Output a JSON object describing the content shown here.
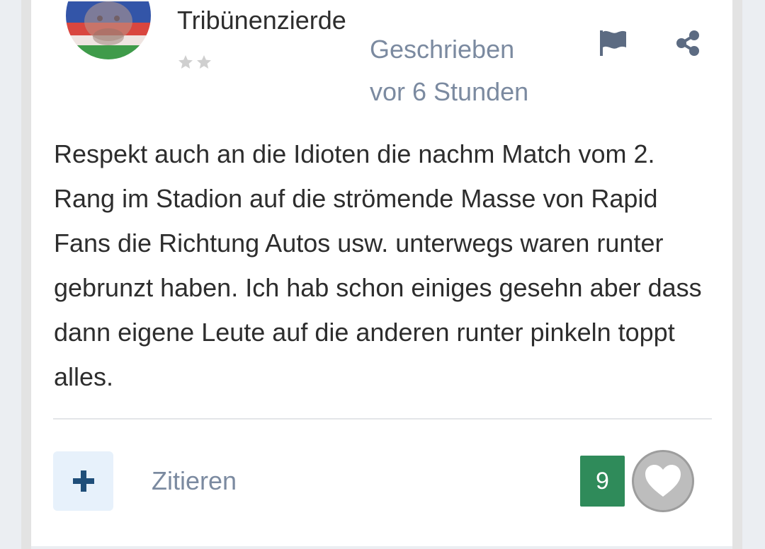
{
  "post": {
    "author_name": "Tribünenzierde",
    "rank_stars": 2,
    "date_line1": "Geschrieben",
    "date_line2": "vor 6 Stunden",
    "body": "Respekt auch an die Idioten die nachm Match vom 2. Rang im Stadion auf die strömende Masse von Rapid Fans die Richtung Autos usw. unterwegs waren runter gebrunzt haben. Ich hab schon einiges gesehn aber dass dann eigene Leute auf die anderen runter pinkeln toppt alles."
  },
  "actions": {
    "plus_icon": "plus-icon",
    "quote_label": "Zitieren",
    "like_count": "9",
    "like_icon": "heart-icon",
    "report_icon": "flag-icon",
    "share_icon": "share-icon"
  },
  "colors": {
    "like_badge": "#2f8b5a",
    "muted_text": "#7b8aa0",
    "plus_button_bg": "#e7f1fb",
    "plus_icon": "#1f4e79"
  }
}
